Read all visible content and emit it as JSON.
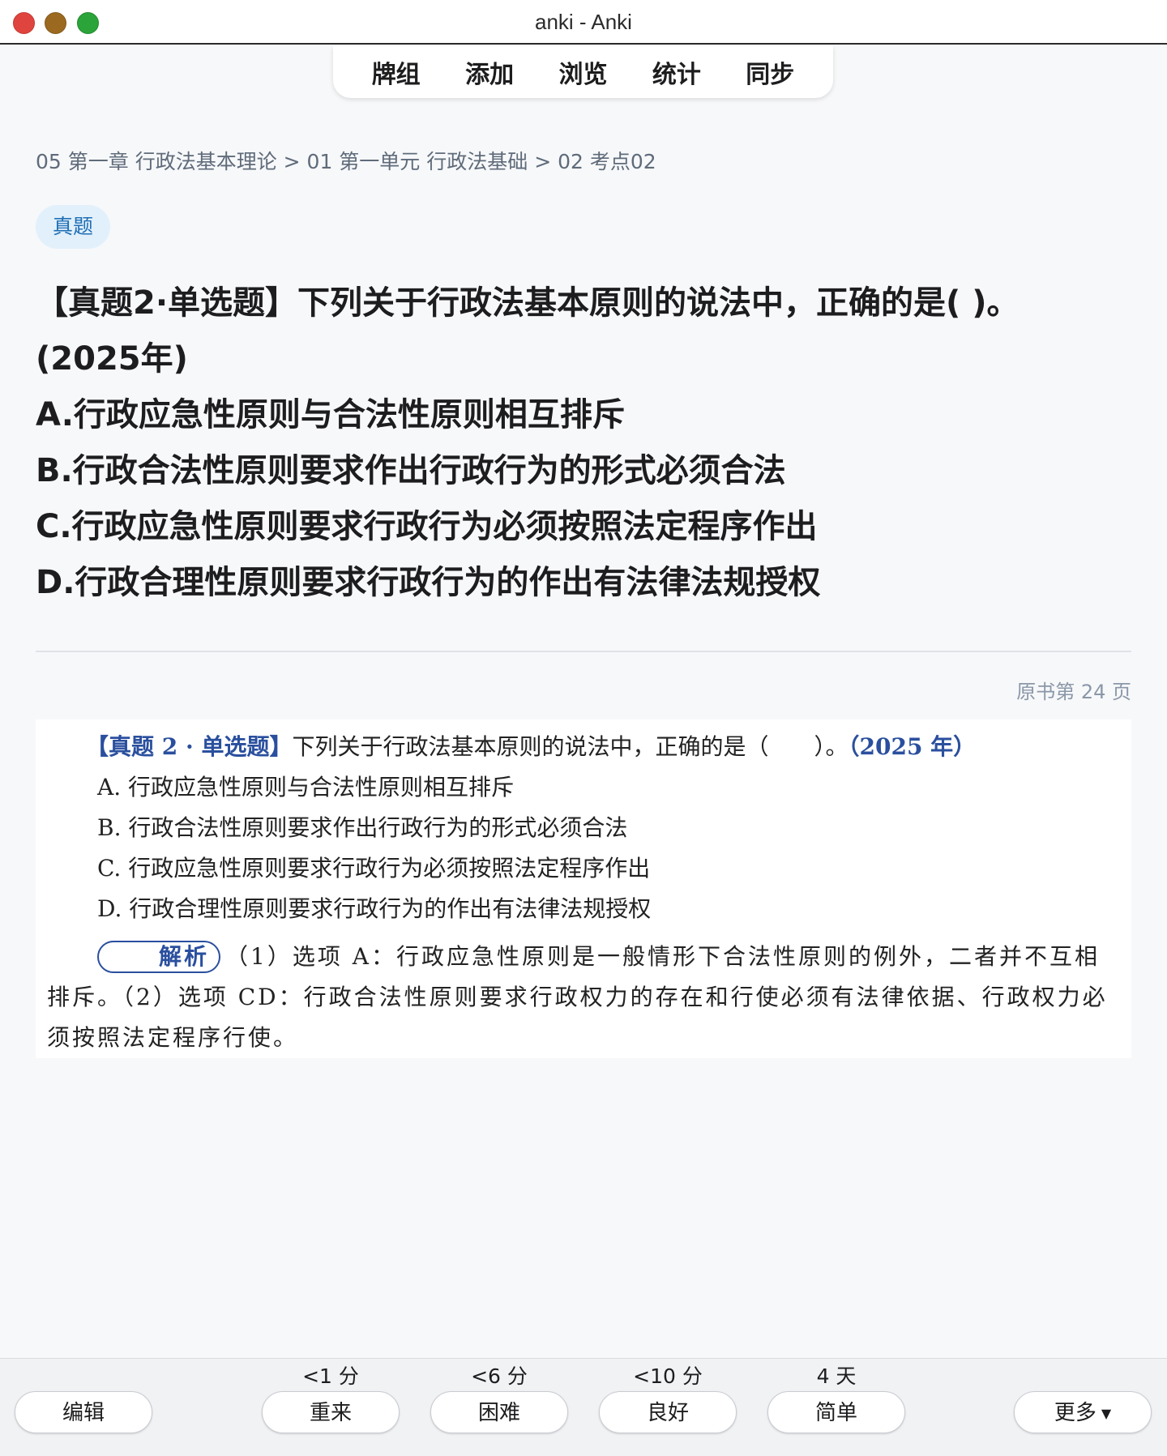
{
  "window": {
    "title": "anki - Anki"
  },
  "toolbar": {
    "items": [
      "牌组",
      "添加",
      "浏览",
      "统计",
      "同步"
    ]
  },
  "breadcrumb": "05 第一章 行政法基本理论 > 01 第一单元 行政法基础 > 02 考点02",
  "tag": "真题",
  "question": {
    "line1": "【真题2·单选题】下列关于行政法基本原则的说法中，正确的是( )。",
    "line2": "(2025年)",
    "options": [
      "A.行政应急性原则与合法性原则相互排斥",
      "B.行政合法性原则要求作出行政行为的形式必须合法",
      "C.行政应急性原则要求行政行为必须按照法定程序作出",
      "D.行政合理性原则要求行政行为的作出有法律法规授权"
    ]
  },
  "page_ref": "原书第 24 页",
  "scan": {
    "heading_tag": "【真题 2 · 单选题】",
    "heading_text": "下列关于行政法基本原则的说法中，正确的是（　　）。",
    "heading_year": "（2025 年）",
    "options": [
      "A. 行政应急性原则与合法性原则相互排斥",
      "B. 行政合法性原则要求作出行政行为的形式必须合法",
      "C. 行政应急性原则要求行政行为必须按照法定程序作出",
      "D. 行政合理性原则要求行政行为的作出有法律法规授权"
    ],
    "analysis_label": "解析",
    "analysis_text": "（1）选项 A：行政应急性原则是一般情形下合法性原则的例外，二者并不互相排斥。（2）选项 CD：行政合法性原则要求行政权力的存在和行使必须有法律依据、行政权力必须按照法定程序行使。"
  },
  "answer_bar": {
    "edit_label": "编辑",
    "more_label": "更多",
    "buttons": [
      {
        "interval": "<1 分",
        "label": "重来"
      },
      {
        "interval": "<6 分",
        "label": "困难"
      },
      {
        "interval": "<10 分",
        "label": "良好"
      },
      {
        "interval": "4 天",
        "label": "简单"
      }
    ]
  }
}
